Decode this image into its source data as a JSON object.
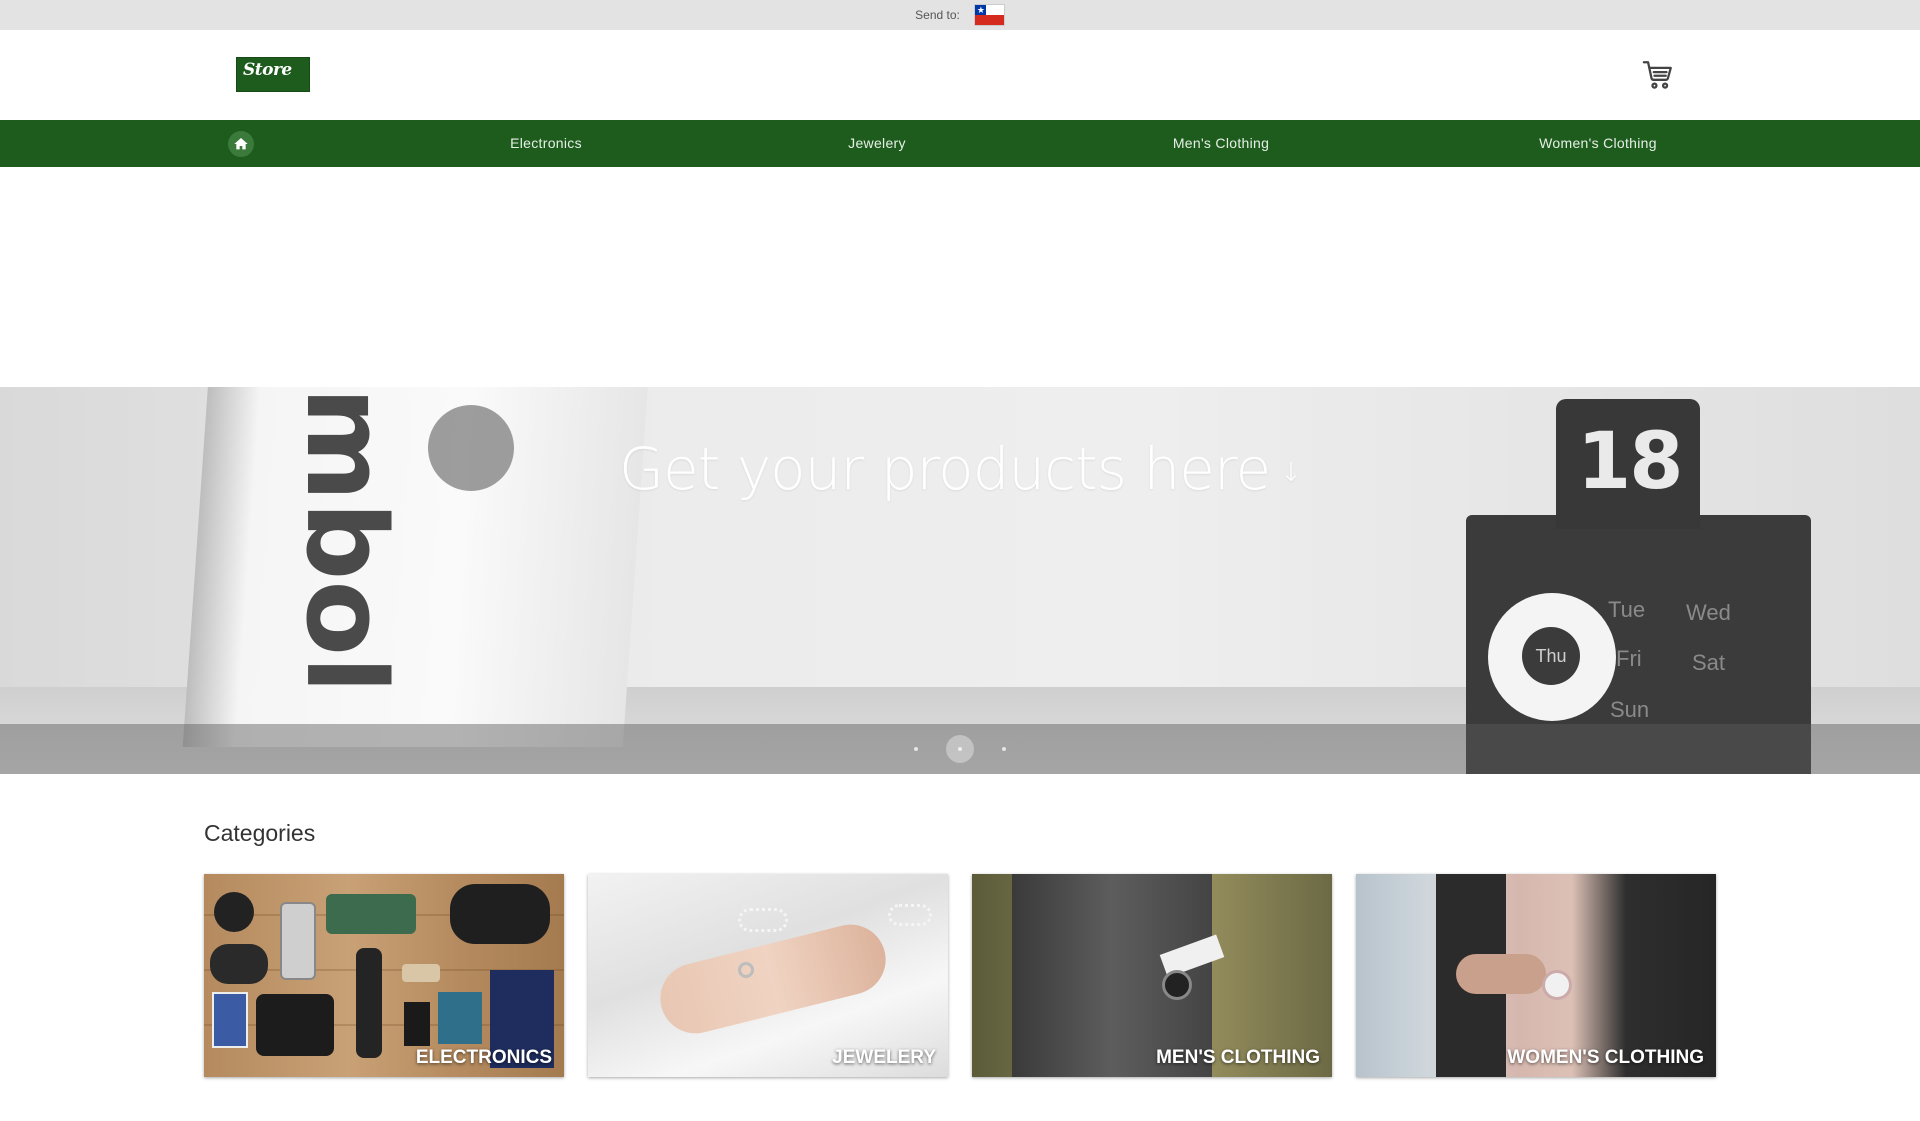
{
  "topbar": {
    "send_label": "Send to:",
    "country_flag": "chile-flag-icon"
  },
  "header": {
    "logo_text": "Store",
    "cart_icon": "cart-icon"
  },
  "nav": {
    "home_icon": "home-icon",
    "items": [
      {
        "label": "Electronics"
      },
      {
        "label": "Jewelery"
      },
      {
        "label": "Men's Clothing"
      },
      {
        "label": "Women's Clothing"
      }
    ]
  },
  "hero": {
    "title": "Get your products here",
    "arrow_icon": "arrow-down-icon",
    "calendar_number": "18",
    "calendar_days": [
      "Tue",
      "Wed",
      "Fri",
      "Sat",
      "Sun",
      "Thu"
    ],
    "book_text": "mbol",
    "slides": 3,
    "active_slide": 2
  },
  "categories": {
    "title": "Categories",
    "items": [
      {
        "label": "ELECTRONICS"
      },
      {
        "label": "JEWELERY"
      },
      {
        "label": "MEN'S CLOTHING"
      },
      {
        "label": "WOMEN'S CLOTHING"
      }
    ]
  },
  "colors": {
    "brand_green": "#1e5c1e",
    "topbar_gray": "#e3e3e3"
  }
}
